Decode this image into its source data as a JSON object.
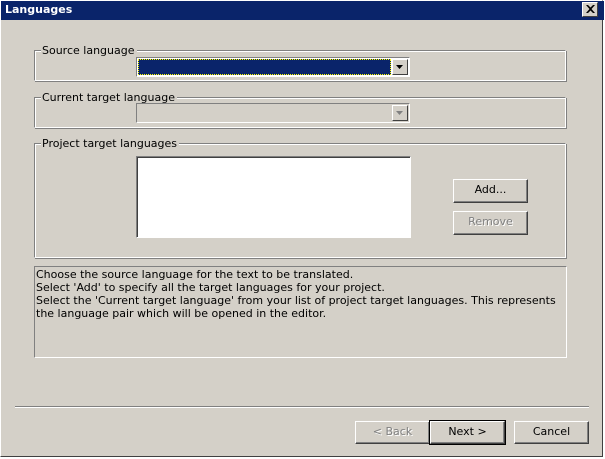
{
  "window": {
    "title": "Languages",
    "close_icon": "close-icon"
  },
  "source_language": {
    "label": "Source language",
    "value": ""
  },
  "current_target_language": {
    "label": "Current target language",
    "value": ""
  },
  "project_target_languages": {
    "label": "Project target languages",
    "items": [],
    "add_label": "Add...",
    "remove_label": "Remove"
  },
  "info": {
    "line1": "Choose the source language for the text to be translated.",
    "line2": "Select 'Add' to specify all the target languages for your project.",
    "line3": "Select the 'Current target language' from your list of project target languages. This represents the language pair which will be opened in the editor."
  },
  "footer": {
    "back_label": "< Back",
    "next_label": "Next >",
    "cancel_label": "Cancel"
  },
  "colors": {
    "titlebar": "#0a246a",
    "face": "#d4d0c8",
    "selection": "#0a246a"
  }
}
